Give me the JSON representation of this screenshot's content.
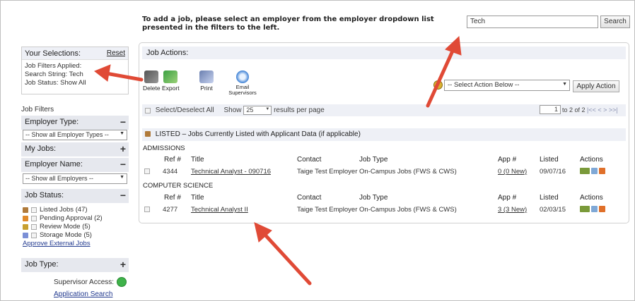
{
  "top": {
    "message": "To add a job, please select an employer from the employer dropdown list presented in the filters to the left.",
    "search_value": "Tech",
    "search_button": "Search"
  },
  "selections": {
    "title": "Your Selections:",
    "reset": "Reset",
    "applied_label": "Job Filters Applied:",
    "search_string": "Search String: Tech",
    "job_status": "Job Status: Show All"
  },
  "filters": {
    "title": "Job Filters",
    "employer_type": {
      "label": "Employer Type:",
      "toggle": "−",
      "select": "-- Show all Employer Types --"
    },
    "my_jobs": {
      "label": "My Jobs:",
      "toggle": "+"
    },
    "employer_name": {
      "label": "Employer Name:",
      "toggle": "−",
      "select": "-- Show all Employers --"
    },
    "job_status": {
      "label": "Job Status:",
      "toggle": "−",
      "items": [
        {
          "label": "Listed Jobs (47)",
          "icon": "listed-icon",
          "color": "#b07a3a"
        },
        {
          "label": "Pending Approval (2)",
          "icon": "pending-icon",
          "color": "#e08a2a"
        },
        {
          "label": "Review Mode (5)",
          "icon": "review-icon",
          "color": "#c8a030"
        },
        {
          "label": "Storage Mode (5)",
          "icon": "storage-icon",
          "color": "#7b8fd6"
        }
      ],
      "approve_link": "Approve External Jobs"
    },
    "job_type": {
      "label": "Job Type:",
      "toggle": "+"
    },
    "supervisor_access": "Supervisor Access:",
    "application_search": "Application Search"
  },
  "main": {
    "job_actions_label": "Job Actions:",
    "tools": [
      {
        "label": "Delete",
        "icon": "delete-icon"
      },
      {
        "label": "Export",
        "icon": "export-icon"
      },
      {
        "label": "Print",
        "icon": "print-icon"
      },
      {
        "label": "Email Supervisors",
        "icon": "email-icon"
      }
    ],
    "action_select": "-- Select Action Below --",
    "apply_button": "Apply Action",
    "select_all": "Select/Deselect All",
    "show_label": "Show",
    "per_page": "25",
    "results_label": "results per page",
    "pager": {
      "page": "1",
      "text": "to 2 of 2",
      "nav": "|<< < > >>|"
    },
    "listed_header": "LISTED – Jobs Currently Listed with Applicant Data (if applicable)",
    "columns": [
      "Ref #",
      "Title",
      "Contact",
      "Job Type",
      "App #",
      "Listed",
      "Actions"
    ],
    "groups": [
      {
        "name": "ADMISSIONS",
        "rows": [
          {
            "ref": "4344",
            "title": "Technical Analyst - 090716",
            "contact": "Taige Test Employer",
            "job_type": "On-Campus Jobs (FWS & CWS)",
            "app": "0 (0 New)",
            "listed": "09/07/16"
          }
        ]
      },
      {
        "name": "COMPUTER SCIENCE",
        "rows": [
          {
            "ref": "4277",
            "title": "Technical Analyst II",
            "contact": "Taige Test Employer",
            "job_type": "On-Campus Jobs (FWS & CWS)",
            "app": "3 (3 New)",
            "listed": "02/03/15"
          }
        ]
      }
    ]
  },
  "colors": {
    "accent_arrow": "#e04a36",
    "header_bg": "#eef0f6",
    "link": "#223a8f"
  }
}
